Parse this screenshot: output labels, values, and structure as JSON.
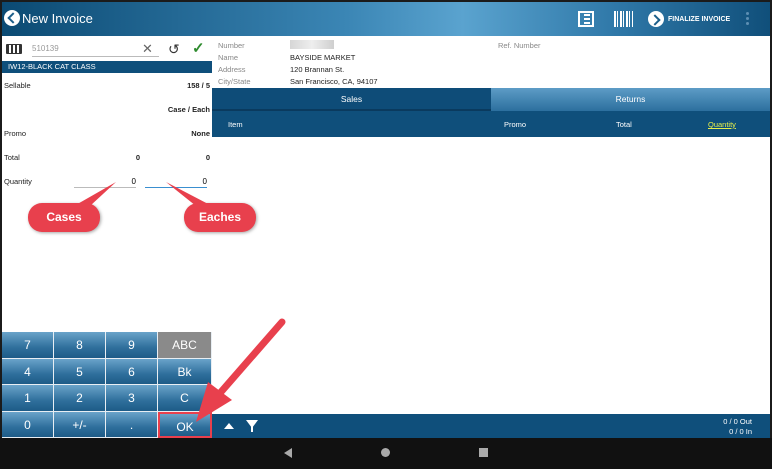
{
  "header": {
    "title": "New Invoice",
    "finalize_label": "FINALIZE INVOICE"
  },
  "left": {
    "search_value": "510139",
    "item_name": "IW12-BLACK CAT CLASS",
    "sellable_label": "Sellable",
    "sellable_value": "158 / 5",
    "unit_header": "Case / Each",
    "promo_label": "Promo",
    "promo_value": "None",
    "total_label": "Total",
    "total_cases": "0",
    "total_eaches": "0",
    "quantity_label": "Quantity",
    "quantity_cases": "0",
    "quantity_eaches": "0"
  },
  "callouts": {
    "cases": "Cases",
    "eaches": "Eaches"
  },
  "keypad": {
    "keys": [
      "7",
      "8",
      "9",
      "ABC",
      "4",
      "5",
      "6",
      "Bk",
      "1",
      "2",
      "3",
      "C",
      "0",
      "+/-",
      ".",
      "OK"
    ]
  },
  "customer": {
    "number_label": "Number",
    "name_label": "Name",
    "name_value": "BAYSIDE MARKET",
    "address_label": "Address",
    "address_value": "120 Brannan St.",
    "city_label": "City/State",
    "city_value": "San Francisco, CA, 94107",
    "ref_label": "Ref. Number"
  },
  "tabs": [
    "Sales",
    "Returns"
  ],
  "columns": {
    "item": "Item",
    "promo": "Promo",
    "total": "Total",
    "quantity": "Quantity"
  },
  "footer": {
    "out": "0 / 0 Out",
    "in": "0 / 0 In"
  },
  "colors": {
    "accent": "#0f4f7b",
    "callout": "#e8404d",
    "quantity_highlight": "#e8f04a"
  }
}
